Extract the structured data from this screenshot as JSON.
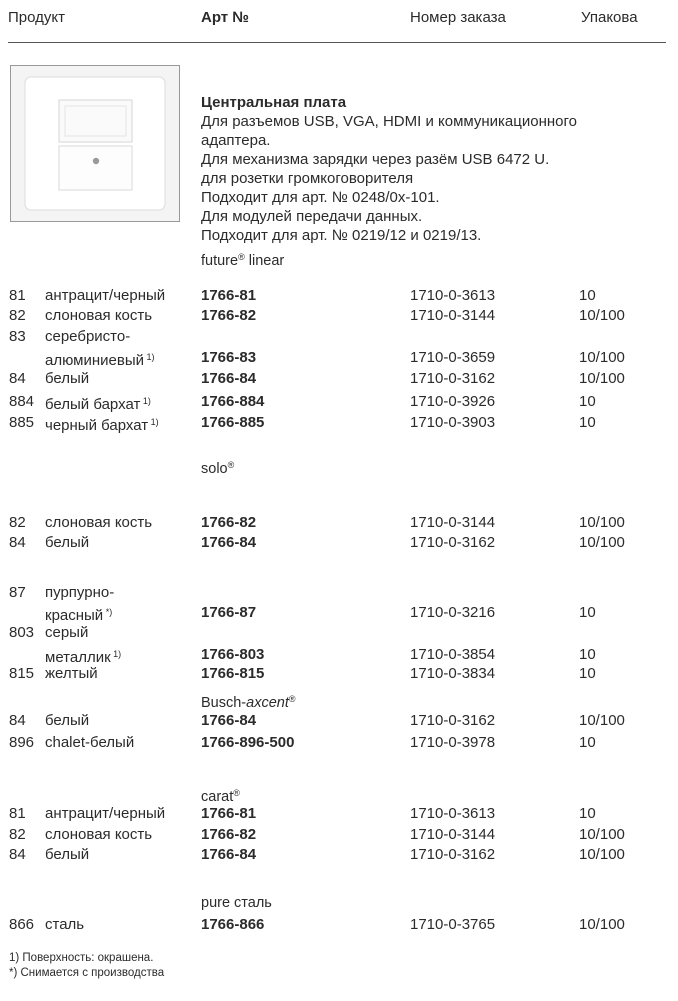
{
  "header": {
    "product": "Продукт",
    "art": "Арт №",
    "order": "Номер заказа",
    "pack": "Упакова"
  },
  "description": {
    "title": "Центральная плата",
    "lines": [
      "Для разъемов USB, VGA, HDMI и коммуникационного",
      "адаптера.",
      "Для механизма зарядки через разём USB 6472 U.",
      "для розетки громкоговорителя",
      "Подходит для арт. № 0248/0x-101.",
      "Для модулей передачи данных.",
      "Подходит для арт. № 0219/12 и 0219/13."
    ]
  },
  "sections": {
    "future": {
      "title": "future",
      "reg": "®",
      "title_rest": " linear"
    },
    "solo": {
      "title": "solo",
      "reg": "®"
    },
    "axcent": {
      "title_a": "Busch-",
      "title_b": "axcent",
      "reg": "®"
    },
    "carat": {
      "title": "carat",
      "reg": "®"
    },
    "pure": {
      "title": "pure сталь"
    }
  },
  "rows": [
    {
      "num": "81",
      "label": "антрацит/черный",
      "sup": "",
      "art": "1766-81",
      "order": "1710-0-3613",
      "pack": "10"
    },
    {
      "num": "82",
      "label": "слоновая кость",
      "sup": "",
      "art": "1766-82",
      "order": "1710-0-3144",
      "pack": "10/100"
    },
    {
      "num": "83",
      "label": "серебристо-",
      "sup": "",
      "art": "",
      "order": "",
      "pack": ""
    },
    {
      "num": "",
      "label": "алюминиевый",
      "sup": "1)",
      "art": "1766-83",
      "order": "1710-0-3659",
      "pack": "10/100"
    },
    {
      "num": "84",
      "label": "белый",
      "sup": "",
      "art": "1766-84",
      "order": "1710-0-3162",
      "pack": "10/100"
    },
    {
      "num": "884",
      "label": "белый бархат",
      "sup": "1)",
      "art": "1766-884",
      "order": "1710-0-3926",
      "pack": "10"
    },
    {
      "num": "885",
      "label": "черный бархат",
      "sup": "1)",
      "art": "1766-885",
      "order": "1710-0-3903",
      "pack": "10"
    },
    {
      "num": "82",
      "label": "слоновая кость",
      "sup": "",
      "art": "1766-82",
      "order": "1710-0-3144",
      "pack": "10/100"
    },
    {
      "num": "84",
      "label": "белый",
      "sup": "",
      "art": "1766-84",
      "order": "1710-0-3162",
      "pack": "10/100"
    },
    {
      "num": "87",
      "label": "пурпурно-",
      "sup": "",
      "art": "",
      "order": "",
      "pack": ""
    },
    {
      "num": "",
      "label": "красный",
      "sup": "*)",
      "art": "1766-87",
      "order": "1710-0-3216",
      "pack": "10"
    },
    {
      "num": "803",
      "label": "серый",
      "sup": "",
      "art": "",
      "order": "",
      "pack": ""
    },
    {
      "num": "",
      "label": "металлик",
      "sup": "1)",
      "art": "1766-803",
      "order": "1710-0-3854",
      "pack": "10"
    },
    {
      "num": "815",
      "label": "желтый",
      "sup": "",
      "art": "1766-815",
      "order": "1710-0-3834",
      "pack": "10"
    },
    {
      "num": "84",
      "label": "белый",
      "sup": "",
      "art": "1766-84",
      "order": "1710-0-3162",
      "pack": "10/100"
    },
    {
      "num": "896",
      "label": "chalet-белый",
      "sup": "",
      "art": "1766-896-500",
      "order": "1710-0-3978",
      "pack": "10"
    },
    {
      "num": "81",
      "label": "антрацит/черный",
      "sup": "",
      "art": "1766-81",
      "order": "1710-0-3613",
      "pack": "10"
    },
    {
      "num": "82",
      "label": "слоновая кость",
      "sup": "",
      "art": "1766-82",
      "order": "1710-0-3144",
      "pack": "10/100"
    },
    {
      "num": "84",
      "label": "белый",
      "sup": "",
      "art": "1766-84",
      "order": "1710-0-3162",
      "pack": "10/100"
    },
    {
      "num": "866",
      "label": "сталь",
      "sup": "",
      "art": "1766-866",
      "order": "1710-0-3765",
      "pack": "10/100"
    }
  ],
  "footnotes": [
    "1)  Поверхность: окрашена.",
    "*)  Снимается с производства"
  ]
}
